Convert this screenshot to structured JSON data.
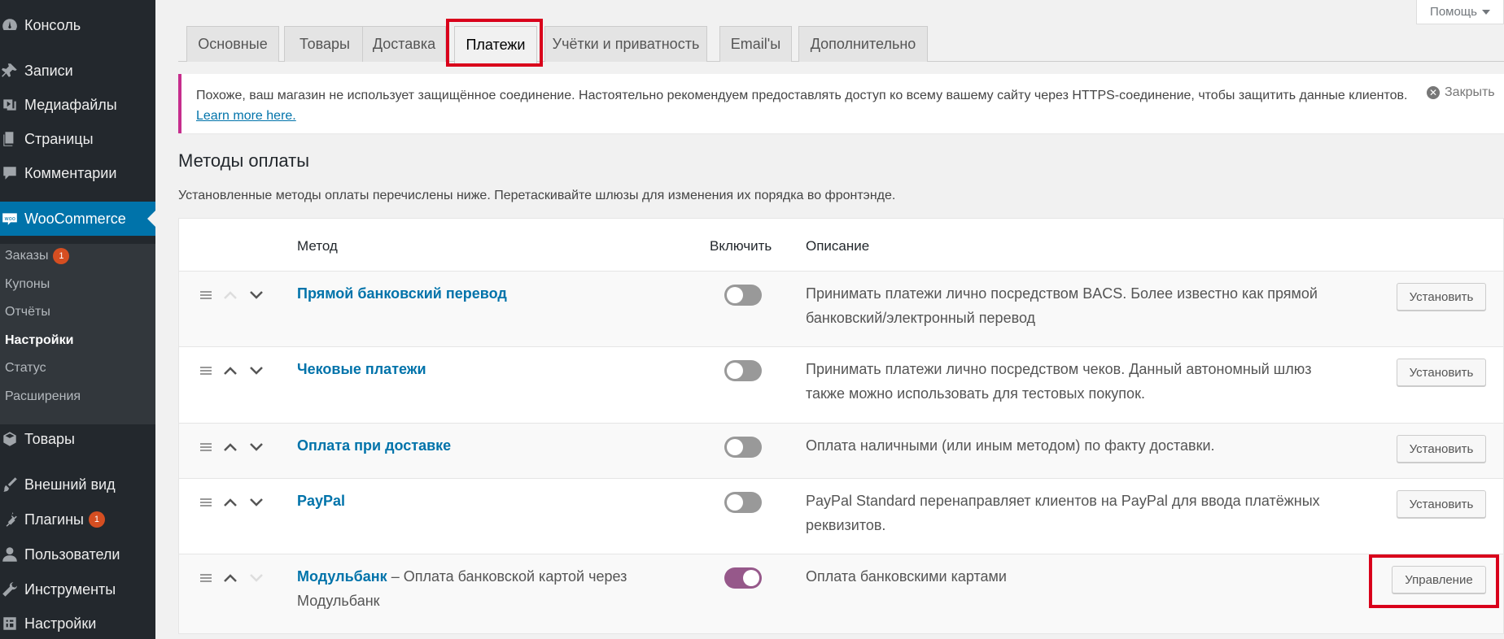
{
  "sidebar": {
    "items": [
      {
        "label": "Консоль",
        "icon": "dashboard-icon"
      },
      {
        "label": "Записи",
        "icon": "pin-icon"
      },
      {
        "label": "Медиафайлы",
        "icon": "media-icon"
      },
      {
        "label": "Страницы",
        "icon": "pages-icon"
      },
      {
        "label": "Комментарии",
        "icon": "comment-icon"
      },
      {
        "label": "WooCommerce",
        "icon": "woo-icon"
      },
      {
        "label": "Товары",
        "icon": "box-icon"
      },
      {
        "label": "Внешний вид",
        "icon": "brush-icon"
      },
      {
        "label": "Плагины",
        "icon": "plugin-icon",
        "badge": "1"
      },
      {
        "label": "Пользователи",
        "icon": "user-icon"
      },
      {
        "label": "Инструменты",
        "icon": "wrench-icon"
      },
      {
        "label": "Настройки",
        "icon": "settings-icon"
      }
    ],
    "submenu": [
      {
        "label": "Заказы",
        "badge": "1"
      },
      {
        "label": "Купоны"
      },
      {
        "label": "Отчёты"
      },
      {
        "label": "Настройки"
      },
      {
        "label": "Статус"
      },
      {
        "label": "Расширения"
      }
    ]
  },
  "help": {
    "label": "Помощь"
  },
  "tabs": [
    {
      "label": "Основные"
    },
    {
      "label": "Товары"
    },
    {
      "label": "Доставка"
    },
    {
      "label": "Платежи"
    },
    {
      "label": "Учётки и приватность"
    },
    {
      "label": "Email'ы"
    },
    {
      "label": "Дополнительно"
    }
  ],
  "notice": {
    "text": "Похоже, ваш магазин не использует защищённое соединение. Настоятельно рекомендуем предоставлять доступ ко всему вашему сайту через HTTPS-соединение, чтобы защитить данные клиентов.",
    "link": "Learn more here.",
    "dismiss": "Закрыть"
  },
  "section": {
    "title": "Методы оплаты",
    "description": "Установленные методы оплаты перечислены ниже. Перетаскивайте шлюзы для изменения их порядка во фронтэнде."
  },
  "table": {
    "headers": {
      "method": "Метод",
      "enable": "Включить",
      "description": "Описание"
    },
    "rows": [
      {
        "name": "Прямой банковский перевод",
        "suffix": "",
        "enabled": false,
        "desc": "Принимать платежи лично посредством BACS. Более известно как прямой банковский/электронный перевод",
        "action": "Установить"
      },
      {
        "name": "Чековые платежи",
        "suffix": "",
        "enabled": false,
        "desc": "Принимать платежи лично посредством чеков. Данный автономный шлюз также можно использовать для тестовых покупок.",
        "action": "Установить"
      },
      {
        "name": "Оплата при доставке",
        "suffix": "",
        "enabled": false,
        "desc": "Оплата наличными (или иным методом) по факту доставки.",
        "action": "Установить"
      },
      {
        "name": "PayPal",
        "suffix": "",
        "enabled": false,
        "desc": "PayPal Standard перенаправляет клиентов на PayPal для ввода платёжных реквизитов.",
        "action": "Установить"
      },
      {
        "name": "Модульбанк",
        "suffix": " – Оплата банковской картой через Модульбанк",
        "enabled": true,
        "desc": "Оплата банковскими картами",
        "action": "Управление"
      }
    ]
  },
  "colors": {
    "accent": "#0073aa",
    "highlight": "#d9001b",
    "toggle_on": "#96588a",
    "sidebar_bg": "#23282d"
  }
}
